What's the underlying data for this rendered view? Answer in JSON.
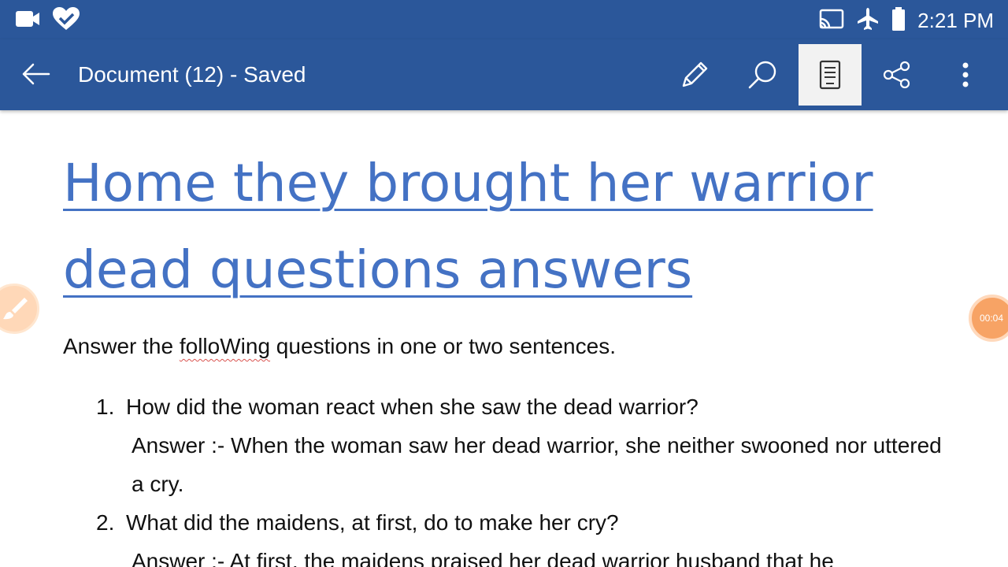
{
  "status_bar": {
    "time": "2:21 PM",
    "left_icons": [
      "video-camera-icon",
      "heart-check-icon"
    ],
    "right_icons": [
      "cast-icon",
      "airplane-mode-icon",
      "battery-icon"
    ]
  },
  "app_bar": {
    "title": "Document (12) - Saved",
    "tools": [
      "pencil-icon",
      "search-icon",
      "reading-view-icon",
      "share-icon",
      "more-options-icon"
    ],
    "active_tool": "reading-view-icon",
    "accent_color": "#2b579a"
  },
  "document": {
    "heading": "Home they brought her warrior dead questions answers",
    "heading_color": "#4472c4",
    "intro": {
      "before": "Answer the ",
      "misspelled": "folloWing",
      "after": " questions in one or two sentences."
    },
    "questions": [
      {
        "number": "1.",
        "question": "How did the woman react when she saw the dead warrior?",
        "answer": "Answer :- When the woman saw her dead warrior, she neither swooned nor uttered a cry."
      },
      {
        "number": "2.",
        "question": "What did the maidens, at first, do to make her cry?",
        "answer": "Answer :-  At first, the maidens praised her dead warrior husband that he"
      }
    ]
  },
  "overlay": {
    "recorder_timer": "00:04"
  }
}
